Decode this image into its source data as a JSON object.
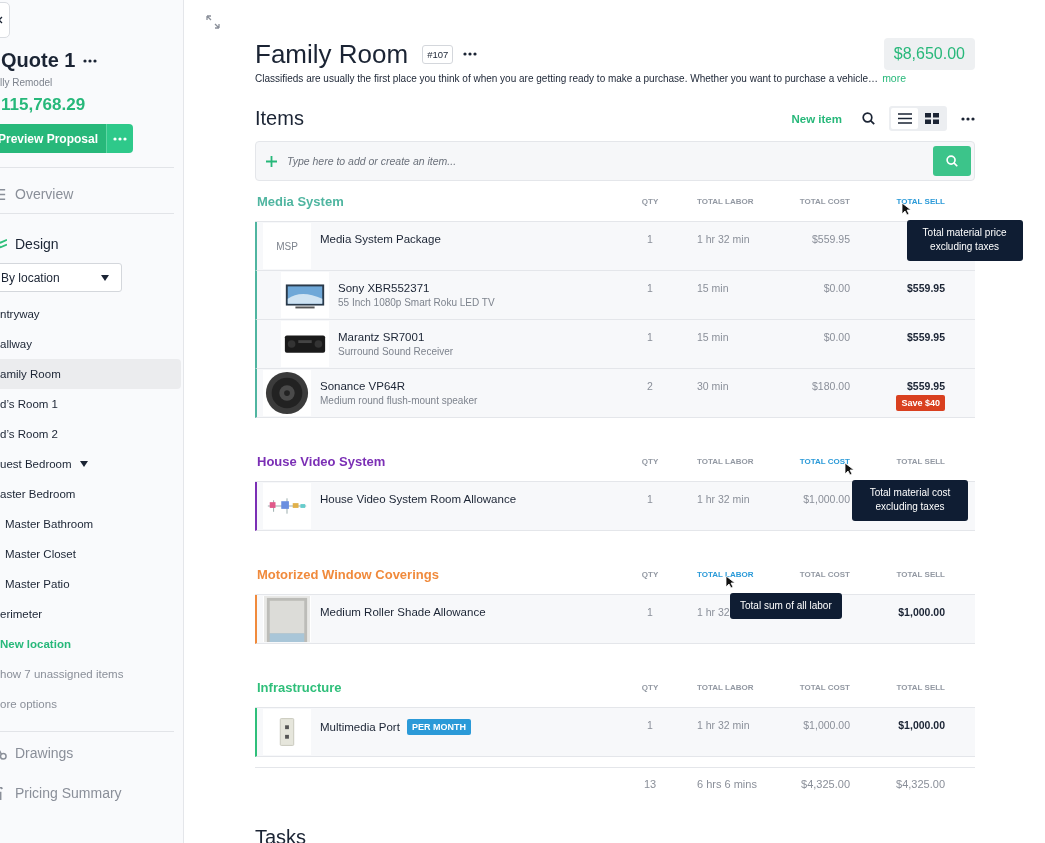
{
  "sidebar": {
    "quote_title": "Quote 1",
    "project": "lly Remodel",
    "total": "115,768.29",
    "preview_button": "Preview Proposal",
    "nav": [
      {
        "label": "Overview",
        "kind": "list",
        "selected": false
      },
      {
        "label": "Design",
        "kind": "layers",
        "selected": true
      }
    ],
    "grouping": "By location",
    "locations": [
      {
        "label": "ntryway",
        "selected": false
      },
      {
        "label": "allway",
        "selected": false
      },
      {
        "label": "amily Room",
        "selected": true
      },
      {
        "label": "d’s Room 1",
        "selected": false
      },
      {
        "label": "d’s Room 2",
        "selected": false
      },
      {
        "label": "uest Bedroom",
        "selected": false,
        "expandable": true
      },
      {
        "label": "aster Bedroom",
        "selected": false,
        "children": [
          {
            "label": "Master Bathroom",
            "selected": false
          },
          {
            "label": "Master Closet",
            "selected": false
          },
          {
            "label": "Master Patio",
            "selected": false
          }
        ]
      },
      {
        "label": "erimeter",
        "selected": false
      }
    ],
    "new_location": "New location",
    "unassigned": "how 7 unassigned items",
    "more_options": "ore options",
    "footer_nav": [
      {
        "label": "Drawings",
        "kind": "drawings",
        "selected": false
      },
      {
        "label": "Pricing Summary",
        "kind": "pricing",
        "selected": false
      }
    ]
  },
  "room": {
    "title": "Family Room",
    "number": "#107",
    "price": "$8,650.00",
    "description": "Classifieds are usually the first place you think of when you are getting ready to make a purchase. Whether you want to purchase a vehicle…",
    "more": "more"
  },
  "items": {
    "title": "Items",
    "new_item": "New item",
    "views": [
      {
        "kind": "list",
        "selected": true
      },
      {
        "kind": "grid",
        "selected": false
      }
    ],
    "search": {
      "placeholder": "Type here to add or create an item..."
    },
    "groups": [
      {
        "title": "Media System",
        "color": "#4fb5a0",
        "columns": [
          {
            "label": "QTY",
            "selected": false
          },
          {
            "label": "TOTAL LABOR",
            "selected": false
          },
          {
            "label": "TOTAL COST",
            "selected": false
          },
          {
            "label": "TOTAL SELL",
            "selected": true,
            "tooltip": "Total material price excluding taxes"
          }
        ],
        "rows": [
          {
            "thumb_text": "MSP",
            "name": "Media System Package",
            "qty": "1",
            "labor": "1 hr 32 min",
            "cost": "$559.95",
            "children": [
              {
                "name": "Sony XBR552371",
                "description": "55 Inch 1080p Smart Roku LED TV",
                "qty": "1",
                "labor": "15 min",
                "cost": "$0.00",
                "sell": "$559.95"
              },
              {
                "name": "Marantz SR7001",
                "description": "Surround Sound Receiver",
                "qty": "1",
                "labor": "15 min",
                "cost": "$0.00",
                "sell": "$559.95"
              }
            ]
          },
          {
            "name": "Sonance VP64R",
            "description": "Medium round flush-mount speaker",
            "qty": "2",
            "labor": "30 min",
            "cost": "$180.00",
            "sell": "$559.95",
            "badge": {
              "kind": "discount",
              "text": "Save $40"
            }
          }
        ]
      },
      {
        "title": "House Video System",
        "color": "#7b2fb5",
        "columns": [
          {
            "label": "QTY",
            "selected": false
          },
          {
            "label": "TOTAL LABOR",
            "selected": false
          },
          {
            "label": "TOTAL COST",
            "selected": true,
            "tooltip": "Total material cost excluding taxes"
          },
          {
            "label": "TOTAL SELL",
            "selected": false
          }
        ],
        "rows": [
          {
            "name": "House Video System Room Allowance",
            "qty": "1",
            "labor": "1 hr 32 min",
            "cost": "$1,000.00"
          }
        ]
      },
      {
        "title": "Motorized Window Coverings",
        "color": "#f08a3c",
        "columns": [
          {
            "label": "QTY",
            "selected": false
          },
          {
            "label": "TOTAL LABOR",
            "selected": true,
            "tooltip": "Total sum of all labor"
          },
          {
            "label": "TOTAL COST",
            "selected": false
          },
          {
            "label": "TOTAL SELL",
            "selected": false
          }
        ],
        "rows": [
          {
            "name": "Medium Roller Shade Allowance",
            "qty": "1",
            "labor": "1 hr 32",
            "sell": "$1,000.00"
          }
        ]
      },
      {
        "title": "Infrastructure",
        "color": "#2fbf7a",
        "columns": [
          {
            "label": "QTY",
            "selected": false
          },
          {
            "label": "TOTAL LABOR",
            "selected": false
          },
          {
            "label": "TOTAL COST",
            "selected": false
          },
          {
            "label": "TOTAL SELL",
            "selected": false
          }
        ],
        "rows": [
          {
            "name": "Multimedia Port",
            "qty": "1",
            "labor": "1 hr 32 min",
            "cost": "$1,000.00",
            "sell": "$1,000.00",
            "badge": {
              "kind": "plan",
              "text": "PER MONTH"
            }
          }
        ]
      }
    ],
    "totals": {
      "qty": "13",
      "labor": "6 hrs 6 mins",
      "cost": "$4,325.00",
      "sell": "$4,325.00"
    }
  },
  "tasks": {
    "title": "Tasks"
  }
}
